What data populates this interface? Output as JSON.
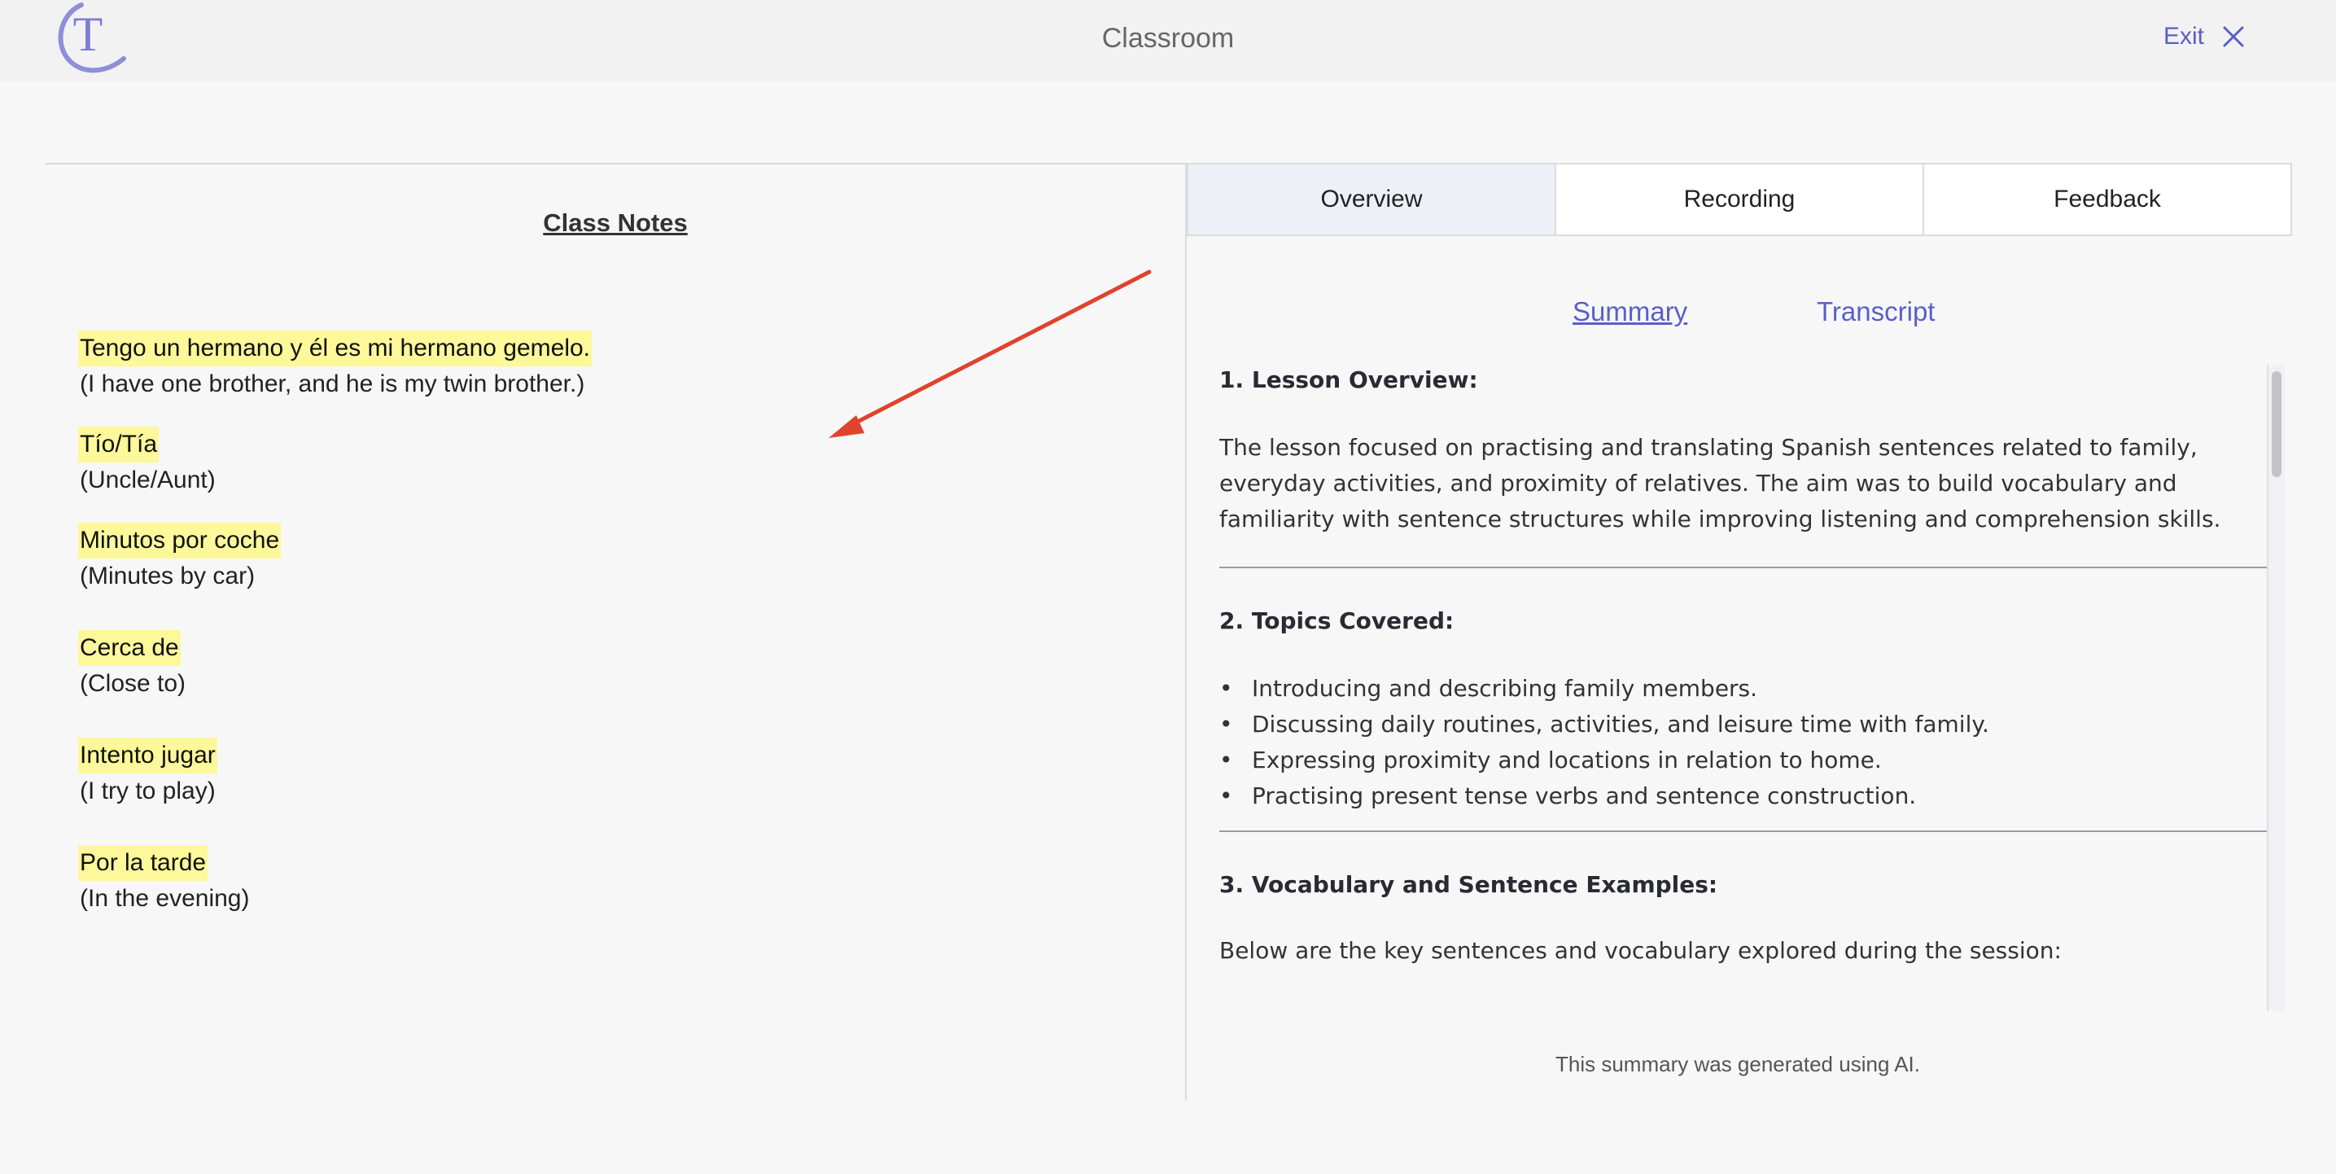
{
  "header": {
    "logo_letter": "T",
    "title": "Classroom",
    "exit_label": "Exit"
  },
  "notes": {
    "title": "Class Notes",
    "items": [
      {
        "es": "Tengo un hermano y él es mi hermano gemelo.",
        "en": "(I have one brother, and he is my twin brother.)"
      },
      {
        "es": "Tío/Tía",
        "en": "(Uncle/Aunt)"
      },
      {
        "es": "Minutos por coche",
        "en": "(Minutes by car)"
      },
      {
        "es": "Cerca de",
        "en": "(Close to)"
      },
      {
        "es": "Intento jugar",
        "en": "(I try to play)"
      },
      {
        "es": "Por la tarde",
        "en": "(In the evening)"
      }
    ]
  },
  "tabs": [
    {
      "label": "Overview",
      "active": true
    },
    {
      "label": "Recording",
      "active": false
    },
    {
      "label": "Feedback",
      "active": false
    }
  ],
  "subtabs": [
    {
      "label": "Summary",
      "active": true
    },
    {
      "label": "Transcript",
      "active": false
    }
  ],
  "summary": {
    "section1_heading": "1. Lesson Overview:",
    "section1_text": "The lesson focused on practising and translating Spanish sentences related to family, everyday activities, and proximity of relatives. The aim was to build vocabulary and familiarity with sentence structures while improving listening and comprehension skills.",
    "section2_heading": "2. Topics Covered:",
    "section2_bullets": [
      "Introducing and describing family members.",
      "Discussing daily routines, activities, and leisure time with family.",
      "Expressing proximity and locations in relation to home.",
      "Practising present tense verbs and sentence construction."
    ],
    "section3_heading": "3. Vocabulary and Sentence Examples:",
    "section3_text": "Below are the key sentences and vocabulary explored during the session:"
  },
  "ai_note": "This summary was generated using AI.",
  "colors": {
    "accent": "#5a5fc8",
    "highlight": "#fdf89a",
    "annotation_arrow": "#e0432d",
    "active_tab_bg": "#eef0f8"
  }
}
